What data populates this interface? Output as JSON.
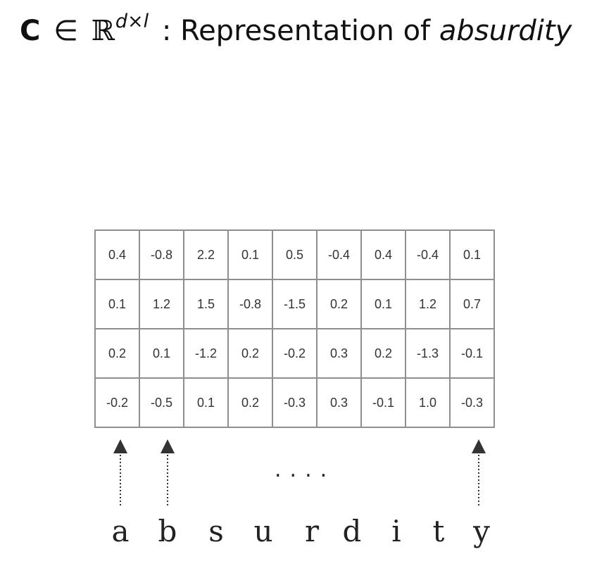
{
  "title": {
    "matrix_symbol": "C",
    "element_of": "∈",
    "real_symbol": "ℝ",
    "superscript": "d×l",
    "text": ": Representation of",
    "word": "absurdity"
  },
  "matrix": [
    [
      "0.4",
      "-0.8",
      "2.2",
      "0.1",
      "0.5",
      "-0.4",
      "0.4",
      "-0.4",
      "0.1"
    ],
    [
      "0.1",
      "1.2",
      "1.5",
      "-0.8",
      "-1.5",
      "0.2",
      "0.1",
      "1.2",
      "0.7"
    ],
    [
      "0.2",
      "0.1",
      "-1.2",
      "0.2",
      "-0.2",
      "0.3",
      "0.2",
      "-1.3",
      "-0.1"
    ],
    [
      "-0.2",
      "-0.5",
      "0.1",
      "0.2",
      "-0.3",
      "0.3",
      "-0.1",
      "1.0",
      "-0.3"
    ]
  ],
  "ellipsis": "....",
  "letters": [
    "a",
    "b",
    "s",
    "u",
    "r",
    "d",
    "i",
    "t",
    "y"
  ]
}
